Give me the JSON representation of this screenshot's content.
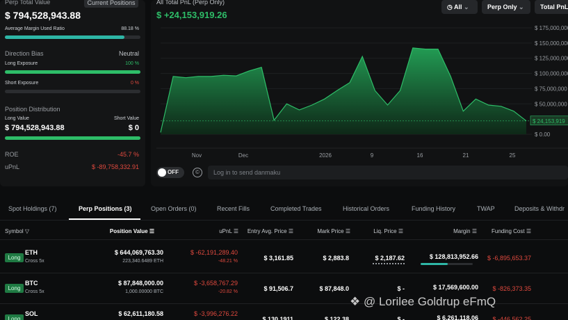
{
  "summary": {
    "perp_total_label": "Perp Total Value",
    "current_positions": "Current Positions",
    "perp_total_value": "$ 794,528,943.88",
    "avg_margin_label": "Average Margin Used Ratio",
    "avg_margin_value": "88.18 %",
    "avg_margin_ratio": 0.8818,
    "direction_label": "Direction Bias",
    "direction_value": "Neutral",
    "long_exposure_label": "Long Exposure",
    "long_exposure_value": "100 %",
    "long_exposure_ratio": 1.0,
    "short_exposure_label": "Short Exposure",
    "short_exposure_value": "0 %",
    "short_exposure_ratio": 0,
    "distribution_label": "Position Distribution",
    "long_value_label": "Long Value",
    "short_value_label": "Short Value",
    "long_value": "$ 794,528,943.88",
    "short_value": "$ 0",
    "roe_label": "ROE",
    "roe_value": "-45.7 %",
    "upnl_label": "uPnL",
    "upnl_value": "$ -89,758,332.91"
  },
  "pnl": {
    "label": "All Total PnL (Perp Only)",
    "value": "$ +24,153,919.26"
  },
  "filters": {
    "all": "All",
    "perp": "Perp Only",
    "total": "Total PnL"
  },
  "chart_data": {
    "type": "area",
    "title": "All Total PnL (Perp Only)",
    "x": [
      "Nov",
      "Dec",
      "2026",
      "9",
      "16",
      "21",
      "25"
    ],
    "y_ticks": [
      "$ 175,000,000",
      "$ 150,000,000",
      "$ 125,000,000",
      "$ 100,000,000",
      "$ 75,000,000",
      "$ 50,000,000",
      "$ 24,153,919",
      "$ 0.00"
    ],
    "ylim": [
      0,
      175000000
    ],
    "current_label": "$ 24,153,919",
    "colors": {
      "line": "#2ebd68",
      "fill": "#1a6b3a"
    },
    "series": [
      {
        "values": [
          3000000,
          95000000,
          93000000,
          95000000,
          95000000,
          97000000,
          96000000,
          104000000,
          110000000,
          23000000,
          50000000,
          40000000,
          48000000,
          58000000,
          72000000,
          85000000,
          128000000,
          72000000,
          48000000,
          72000000,
          142000000,
          140000000,
          140000000,
          95000000,
          38000000,
          58000000,
          48000000,
          46000000,
          38000000,
          22000000
        ]
      }
    ]
  },
  "danmaku": {
    "toggle": "OFF",
    "placeholder": "Log in to send danmaku"
  },
  "tabs": [
    "Spot Holdings (7)",
    "Perp Positions (3)",
    "Open Orders (0)",
    "Recent Fills",
    "Completed Trades",
    "Historical Orders",
    "Funding History",
    "TWAP",
    "Deposits & Withdr"
  ],
  "columns": [
    "Symbol",
    "Position Value",
    "uPnL",
    "Entry Avg. Price",
    "Mark Price",
    "Liq. Price",
    "Margin",
    "Funding Cost"
  ],
  "rows": [
    {
      "side": "Long",
      "symbol": "ETH",
      "mode": "Cross 5x",
      "value": "$ 644,069,763.30",
      "qty": "223,340.6489 ETH",
      "upnl": "$ -62,191,289.40",
      "upnl_pct": "-48.21 %",
      "entry": "$ 3,161.85",
      "mark": "$ 2,883.8",
      "liq": "$ 2,187.62",
      "margin": "$ 128,813,952.66",
      "funding": "$ -6,895,653.37"
    },
    {
      "side": "Long",
      "symbol": "BTC",
      "mode": "Cross 5x",
      "value": "$ 87,848,000.00",
      "qty": "1,000.00000 BTC",
      "upnl": "$ -3,658,767.29",
      "upnl_pct": "-20.82 %",
      "entry": "$ 91,506.7",
      "mark": "$ 87,848.0",
      "liq": "$ -",
      "margin": "$ 17,569,600.00",
      "funding": "$ -826,373.35"
    },
    {
      "side": "Long",
      "symbol": "SOL",
      "mode": "Cross 5x",
      "value": "$ 62,611,180.58",
      "qty": "",
      "upnl": "$ -3,996,276.22",
      "upnl_pct": "",
      "entry": "$ 130.1911",
      "mark": "$ 122.38",
      "liq": "$ -",
      "margin": "$ 6,261,118.06",
      "funding": "$ -446,562.25"
    }
  ],
  "watermark": "@ Lorilee Goldrup eFmQ"
}
